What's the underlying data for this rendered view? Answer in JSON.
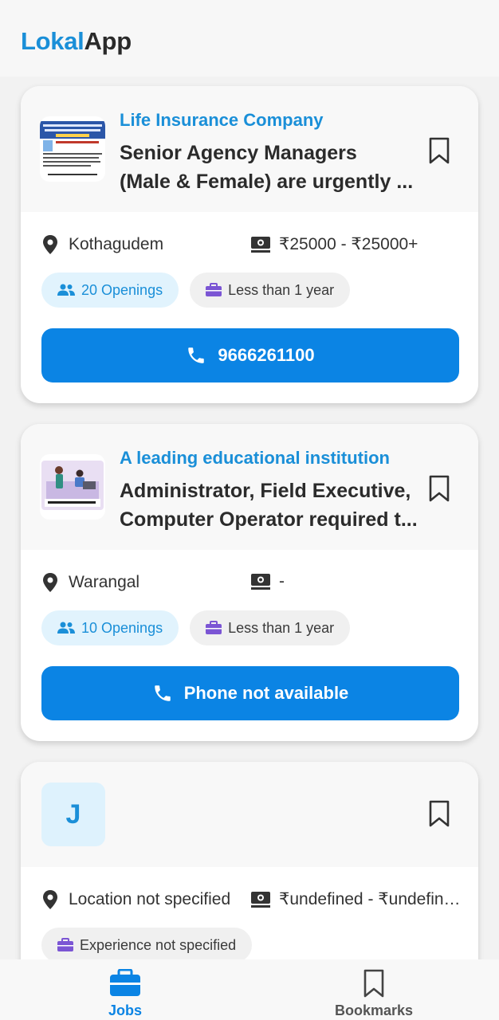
{
  "app": {
    "name_part1": "Lokal",
    "name_part2": "App"
  },
  "jobs": [
    {
      "company": "Life Insurance Company",
      "title_line1": "Senior Agency Managers",
      "title_line2": "(Male & Female) are urgently ...",
      "location": "Kothagudem",
      "salary": "₹25000 - ₹25000+",
      "openings": "20 Openings",
      "experience": "Less than 1 year",
      "button_label": "9666261100"
    },
    {
      "company": "A leading educational institution",
      "title_line1": "Administrator, Field Executive,",
      "title_line2": "Computer Operator required t...",
      "location": "Warangal",
      "salary": "-",
      "openings": "10 Openings",
      "experience": "Less than 1 year",
      "button_label": "Phone not available"
    },
    {
      "initial": "J",
      "location": "Location not specified",
      "salary": "₹undefined - ₹undefined",
      "experience": "Experience not specified"
    }
  ],
  "nav": {
    "jobs_label": "Jobs",
    "bookmarks_label": "Bookmarks"
  },
  "colors": {
    "accent": "#0b84e4",
    "brand": "#1a8fd8"
  },
  "icons": [
    "location-pin-icon",
    "money-icon",
    "people-icon",
    "briefcase-icon",
    "phone-icon",
    "bookmark-icon"
  ]
}
